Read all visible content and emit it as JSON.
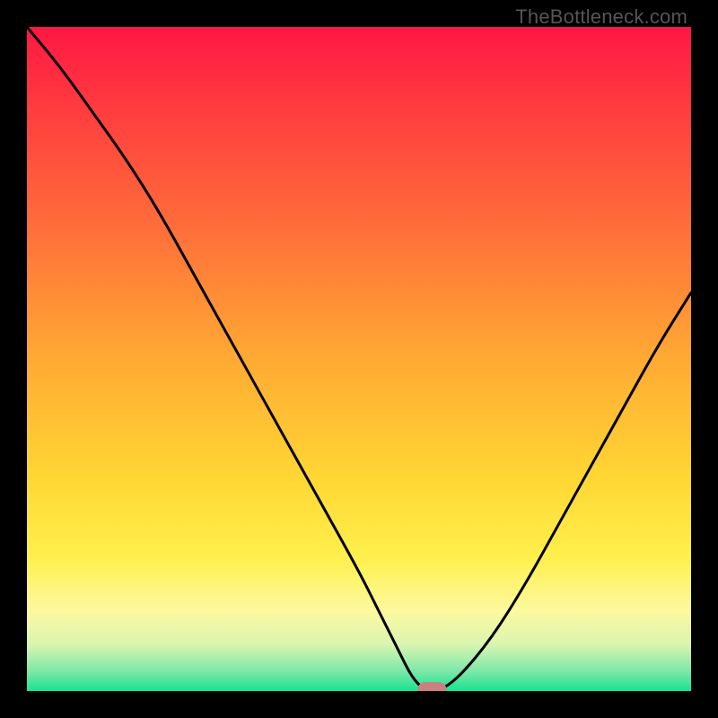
{
  "watermark": "TheBottleneck.com",
  "chart_data": {
    "type": "line",
    "title": "",
    "xlabel": "",
    "ylabel": "",
    "xlim": [
      0,
      100
    ],
    "ylim": [
      0,
      100
    ],
    "grid": false,
    "legend": false,
    "series": [
      {
        "name": "bottleneck-curve",
        "x": [
          0,
          5,
          10,
          15,
          20,
          25,
          30,
          35,
          40,
          45,
          50,
          53,
          56,
          58,
          60,
          62,
          65,
          70,
          75,
          80,
          85,
          90,
          95,
          100
        ],
        "y": [
          100,
          94,
          87,
          80,
          72,
          63,
          54,
          45,
          36,
          27,
          18,
          12,
          6,
          2,
          0,
          0,
          2,
          8,
          16,
          25,
          34,
          43,
          52,
          60
        ]
      }
    ],
    "marker": {
      "x": 61,
      "y": 0,
      "color": "#c98080"
    },
    "background_gradient": {
      "stops": [
        {
          "offset": 0.0,
          "color": "#ff1744"
        },
        {
          "offset": 0.12,
          "color": "#ff3b3f"
        },
        {
          "offset": 0.3,
          "color": "#ff6d3a"
        },
        {
          "offset": 0.5,
          "color": "#ffaa33"
        },
        {
          "offset": 0.68,
          "color": "#ffd733"
        },
        {
          "offset": 0.8,
          "color": "#fff04d"
        },
        {
          "offset": 0.88,
          "color": "#fcf9a0"
        },
        {
          "offset": 0.93,
          "color": "#d9f5b0"
        },
        {
          "offset": 0.97,
          "color": "#7de8a8"
        },
        {
          "offset": 1.0,
          "color": "#19e28f"
        }
      ]
    }
  }
}
